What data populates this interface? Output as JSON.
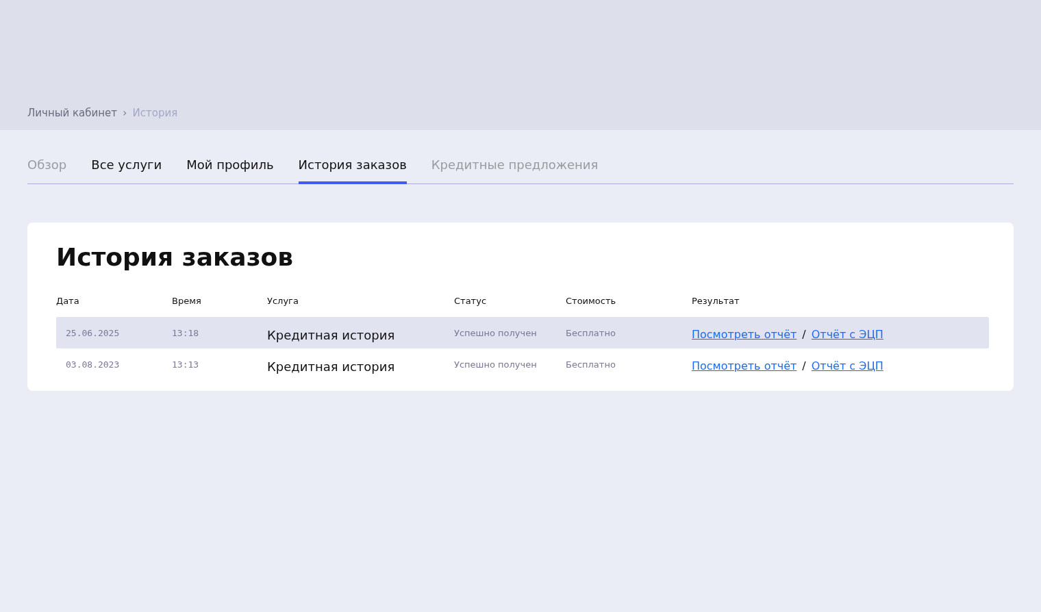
{
  "breadcrumb": [
    {
      "label": "Личный кабинет",
      "current": false
    },
    {
      "label": "История",
      "current": true
    }
  ],
  "breadcrumb_separator": "›",
  "tabs": [
    {
      "label": "Обзор",
      "selected": false,
      "disabled": true
    },
    {
      "label": "Все услуги",
      "selected": false,
      "disabled": false
    },
    {
      "label": "Мой профиль",
      "selected": false,
      "disabled": false
    },
    {
      "label": "История заказов",
      "selected": true,
      "disabled": false
    },
    {
      "label": "Кредитные предложения",
      "selected": false,
      "disabled": true
    }
  ],
  "card": {
    "title": "История заказов",
    "table": {
      "columns": [
        "Дата",
        "Время",
        "Услуга",
        "Статус",
        "Стоимость",
        "Результат"
      ],
      "rows": [
        {
          "date": "25.06.2025",
          "time": "13:18",
          "service": "Кредитная история",
          "status": "Успешно получен",
          "cost": "Бесплатно",
          "links": [
            "Посмотреть отчёт",
            "Отчёт с ЭЦП"
          ],
          "separator": "/",
          "selected": true
        },
        {
          "date": "03.08.2023",
          "time": "13:13",
          "service": "Кредитная история",
          "status": "Успешно получен",
          "cost": "Бесплатно",
          "links": [
            "Посмотреть отчёт",
            "Отчёт с ЭЦП"
          ],
          "separator": "/",
          "selected": false
        }
      ]
    }
  }
}
